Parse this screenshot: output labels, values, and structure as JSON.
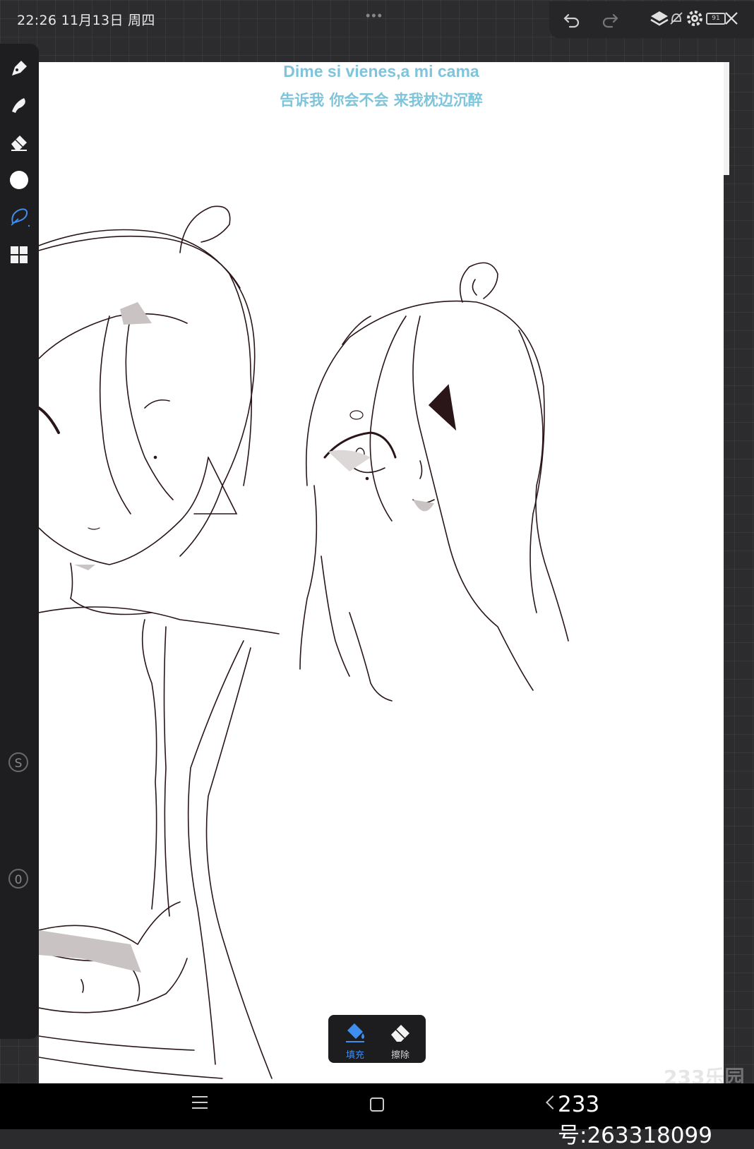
{
  "status_bar": {
    "time_date": "22:26  11月13日 周四",
    "dots": "•••",
    "battery_level": "91"
  },
  "canvas": {
    "lyric_line_1": "Dime si vienes,a mi cama",
    "lyric_line_2": "告诉我 你会不会 来我枕边沉醉"
  },
  "left_toolbar": {
    "tools": [
      "brush-tool",
      "smudge-tool",
      "eraser-tool",
      "color-picker",
      "selection-lasso-tool",
      "layers-grid-tool"
    ],
    "side_buttons": [
      "S",
      "0"
    ]
  },
  "fill_popup": {
    "fill_label": "填充",
    "erase_label": "擦除",
    "accent_color": "#3d8ef0"
  },
  "watermark": "233乐园",
  "nav_bar": {
    "uid_text": "233号:263318099"
  }
}
